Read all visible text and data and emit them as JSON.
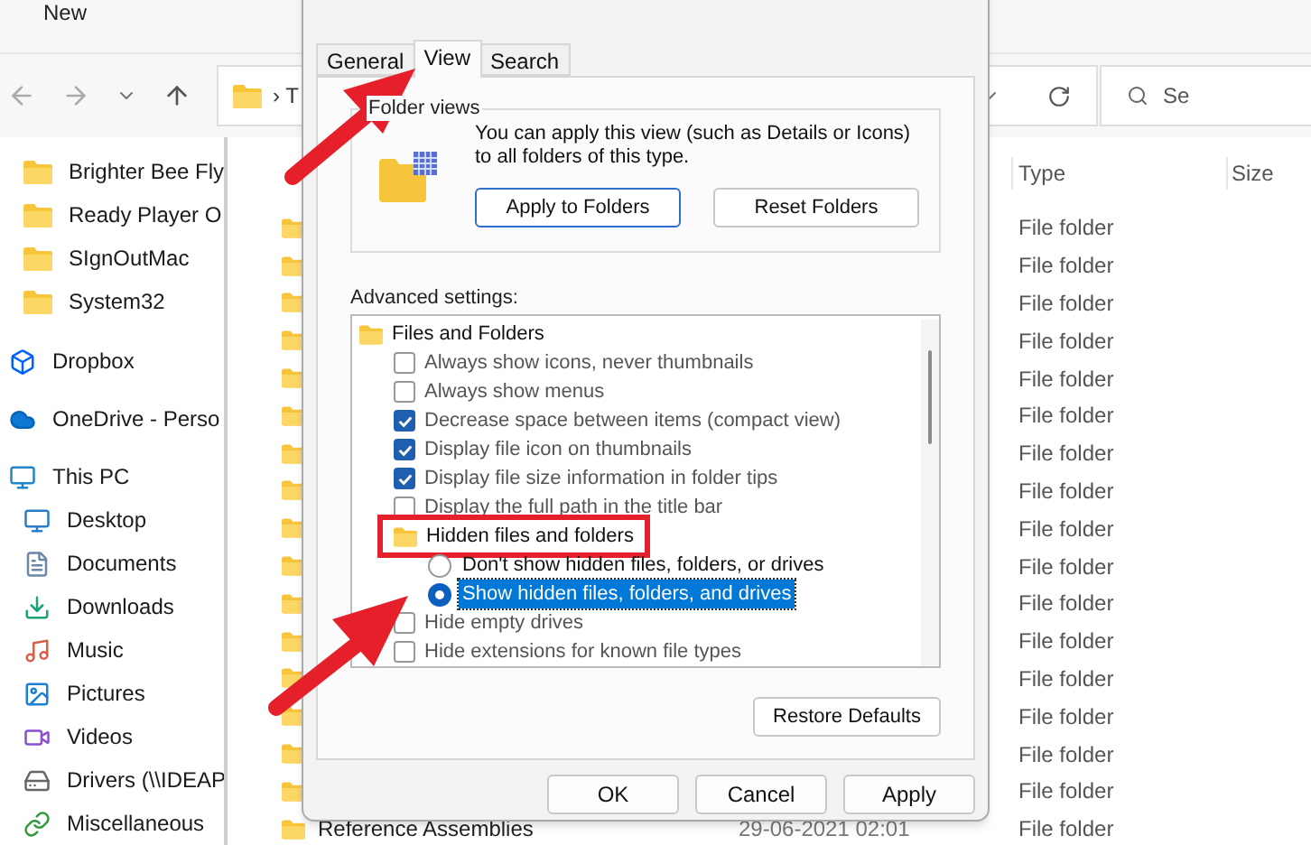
{
  "toolbar": {
    "new_label": "New"
  },
  "address_bar": {
    "path_start": "› T",
    "search_placeholder": "Se"
  },
  "sidebar": {
    "items": [
      {
        "label": "Brighter Bee Fly",
        "kind": "folder"
      },
      {
        "label": "Ready Player O",
        "kind": "folder"
      },
      {
        "label": "SIgnOutMac",
        "kind": "folder"
      },
      {
        "label": "System32",
        "kind": "folder"
      },
      {
        "label": "Dropbox",
        "kind": "dropbox"
      },
      {
        "label": "OneDrive - Perso",
        "kind": "cloud"
      },
      {
        "label": "This PC",
        "kind": "pc",
        "children": [
          {
            "label": "Desktop",
            "kind": "desktop"
          },
          {
            "label": "Documents",
            "kind": "documents"
          },
          {
            "label": "Downloads",
            "kind": "downloads"
          },
          {
            "label": "Music",
            "kind": "music"
          },
          {
            "label": "Pictures",
            "kind": "pictures"
          },
          {
            "label": "Videos",
            "kind": "videos"
          },
          {
            "label": "Drivers (\\\\IDEAP",
            "kind": "drive"
          },
          {
            "label": "Miscellaneous",
            "kind": "shortcut"
          }
        ]
      }
    ]
  },
  "file_list": {
    "columns": {
      "type": "Type",
      "size": "Size"
    },
    "rows": [
      {
        "type": "File folder"
      },
      {
        "type": "File folder"
      },
      {
        "type": "File folder"
      },
      {
        "type": "File folder"
      },
      {
        "type": "File folder"
      },
      {
        "type": "File folder"
      },
      {
        "type": "File folder"
      },
      {
        "type": "File folder"
      },
      {
        "type": "File folder"
      },
      {
        "type": "File folder"
      },
      {
        "type": "File folder"
      },
      {
        "type": "File folder"
      },
      {
        "type": "File folder"
      },
      {
        "type": "File folder"
      },
      {
        "type": "File folder"
      },
      {
        "type": "File folder"
      },
      {
        "name": "Reference Assemblies",
        "date": "29-06-2021 02:01",
        "type": "File folder"
      }
    ]
  },
  "dialog": {
    "tabs": [
      {
        "label": "General",
        "selected": false
      },
      {
        "label": "View",
        "selected": true
      },
      {
        "label": "Search",
        "selected": false
      }
    ],
    "folder_views": {
      "title": "Folder views",
      "description": "You can apply this view (such as Details or Icons) to all folders of this type.",
      "buttons": [
        "Apply to Folders",
        "Reset Folders"
      ]
    },
    "advanced_label": "Advanced settings:",
    "settings": [
      {
        "kind": "group",
        "label": "Files and Folders",
        "annotated": false,
        "children": [
          {
            "kind": "checkbox",
            "label": "Always show icons, never thumbnails",
            "checked": false
          },
          {
            "kind": "checkbox",
            "label": "Always show menus",
            "checked": false
          },
          {
            "kind": "checkbox",
            "label": "Decrease space between items (compact view)",
            "checked": true
          },
          {
            "kind": "checkbox",
            "label": "Display file icon on thumbnails",
            "checked": true
          },
          {
            "kind": "checkbox",
            "label": "Display file size information in folder tips",
            "checked": true
          },
          {
            "kind": "checkbox",
            "label": "Display the full path in the title bar",
            "checked": false
          },
          {
            "kind": "group",
            "label": "Hidden files and folders",
            "annotated": true,
            "children": [
              {
                "kind": "radio",
                "label": "Don't show hidden files, folders, or drives",
                "selected": false
              },
              {
                "kind": "radio",
                "label": "Show hidden files, folders, and drives",
                "selected": true
              }
            ]
          },
          {
            "kind": "checkbox",
            "label": "Hide empty drives",
            "checked": false
          },
          {
            "kind": "checkbox",
            "label": "Hide extensions for known file types",
            "checked": false
          }
        ]
      }
    ],
    "restore_button": "Restore Defaults",
    "buttons": [
      "OK",
      "Cancel",
      "Apply"
    ]
  }
}
